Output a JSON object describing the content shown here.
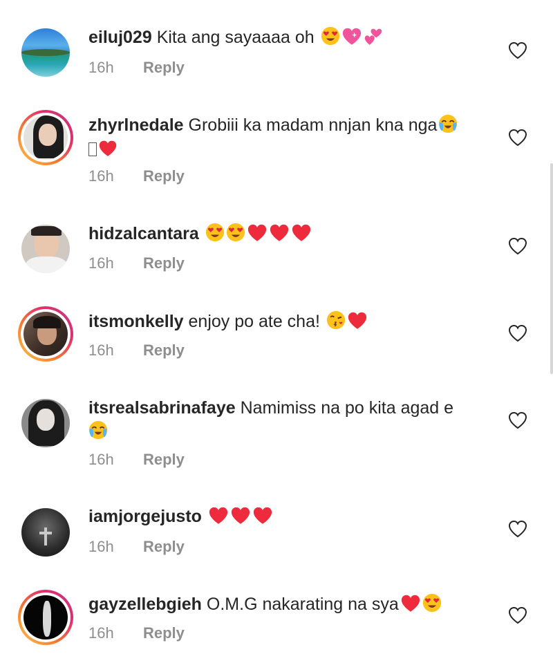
{
  "comments": [
    {
      "username": "eiluj029",
      "text": "Kita ang sayaaaa oh",
      "time": "16h",
      "reply": "Reply"
    },
    {
      "username": "zhyrlnedale",
      "text": "Grobiii ka madam nnjan kna nga",
      "time": "16h",
      "reply": "Reply"
    },
    {
      "username": "hidzalcantara",
      "text": "",
      "time": "16h",
      "reply": "Reply"
    },
    {
      "username": "itsmonkelly",
      "text": "enjoy po ate cha!",
      "time": "16h",
      "reply": "Reply"
    },
    {
      "username": "itsrealsabrinafaye",
      "text": "Namimiss na po kita agad e",
      "time": "16h",
      "reply": "Reply"
    },
    {
      "username": "iamjorgejusto",
      "text": "",
      "time": "16h",
      "reply": "Reply"
    },
    {
      "username": "gayzellebgieh",
      "text": "O.M.G nakarating na sya",
      "time": "16h",
      "reply": "Reply"
    }
  ],
  "colors": {
    "text": "#262626",
    "muted": "#8e8e8e",
    "heart": "#ee2a3d",
    "story_ring": "#e1306c"
  }
}
